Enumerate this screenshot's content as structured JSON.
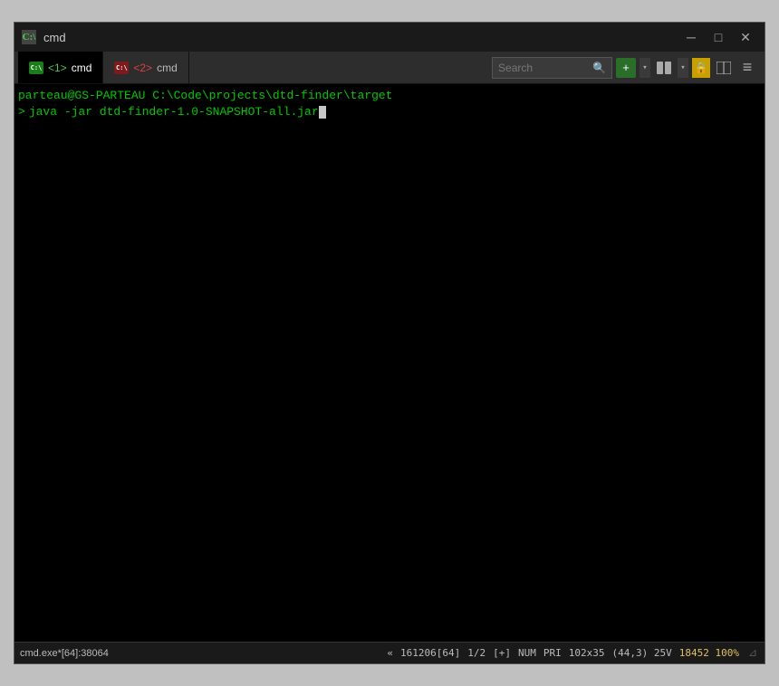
{
  "window": {
    "title": "cmd",
    "title_icon": "■"
  },
  "title_bar": {
    "minimize_label": "─",
    "maximize_label": "□",
    "close_label": "✕"
  },
  "tabs": [
    {
      "id": "tab1",
      "icon_text": "?",
      "number": "1>",
      "label": "cmd",
      "active": true
    },
    {
      "id": "tab2",
      "icon_text": "?",
      "number": "2>",
      "label": "cmd",
      "active": false
    }
  ],
  "toolbar": {
    "search_placeholder": "Search",
    "add_button_label": "+",
    "dropdown_arrow": "▾",
    "pane_button_label": "▥",
    "pane_dropdown_arrow": "▾",
    "lock_icon": "🔒",
    "split_pane_label": "⊟",
    "menu_label": "≡"
  },
  "terminal": {
    "prompt_line": "parteau@GS-PARTEAU C:\\Code\\projects\\dtd-finder\\target",
    "prompt_char": ">",
    "command": "java -jar dtd-finder-1.0-SNAPSHOT-all.jar"
  },
  "status_bar": {
    "left_text": "cmd.exe*[64]:38064",
    "separator": "«",
    "position1": "161206[64]",
    "position2": "1/2",
    "insert_mode": "[+]",
    "num_lock": "NUM",
    "priority": "PRI",
    "dimensions": "102x35",
    "coords": "(44,3) 25V",
    "memory": "18452 100%"
  },
  "colors": {
    "terminal_bg": "#000000",
    "terminal_fg": "#00c800",
    "tab_active_bg": "#000000",
    "tab_bar_bg": "#2d2d2d",
    "title_bar_bg": "#1a1a1a",
    "status_bar_bg": "#1a1a1a",
    "add_btn_bg": "#2a6e2a",
    "lock_btn_bg": "#c8a000"
  }
}
